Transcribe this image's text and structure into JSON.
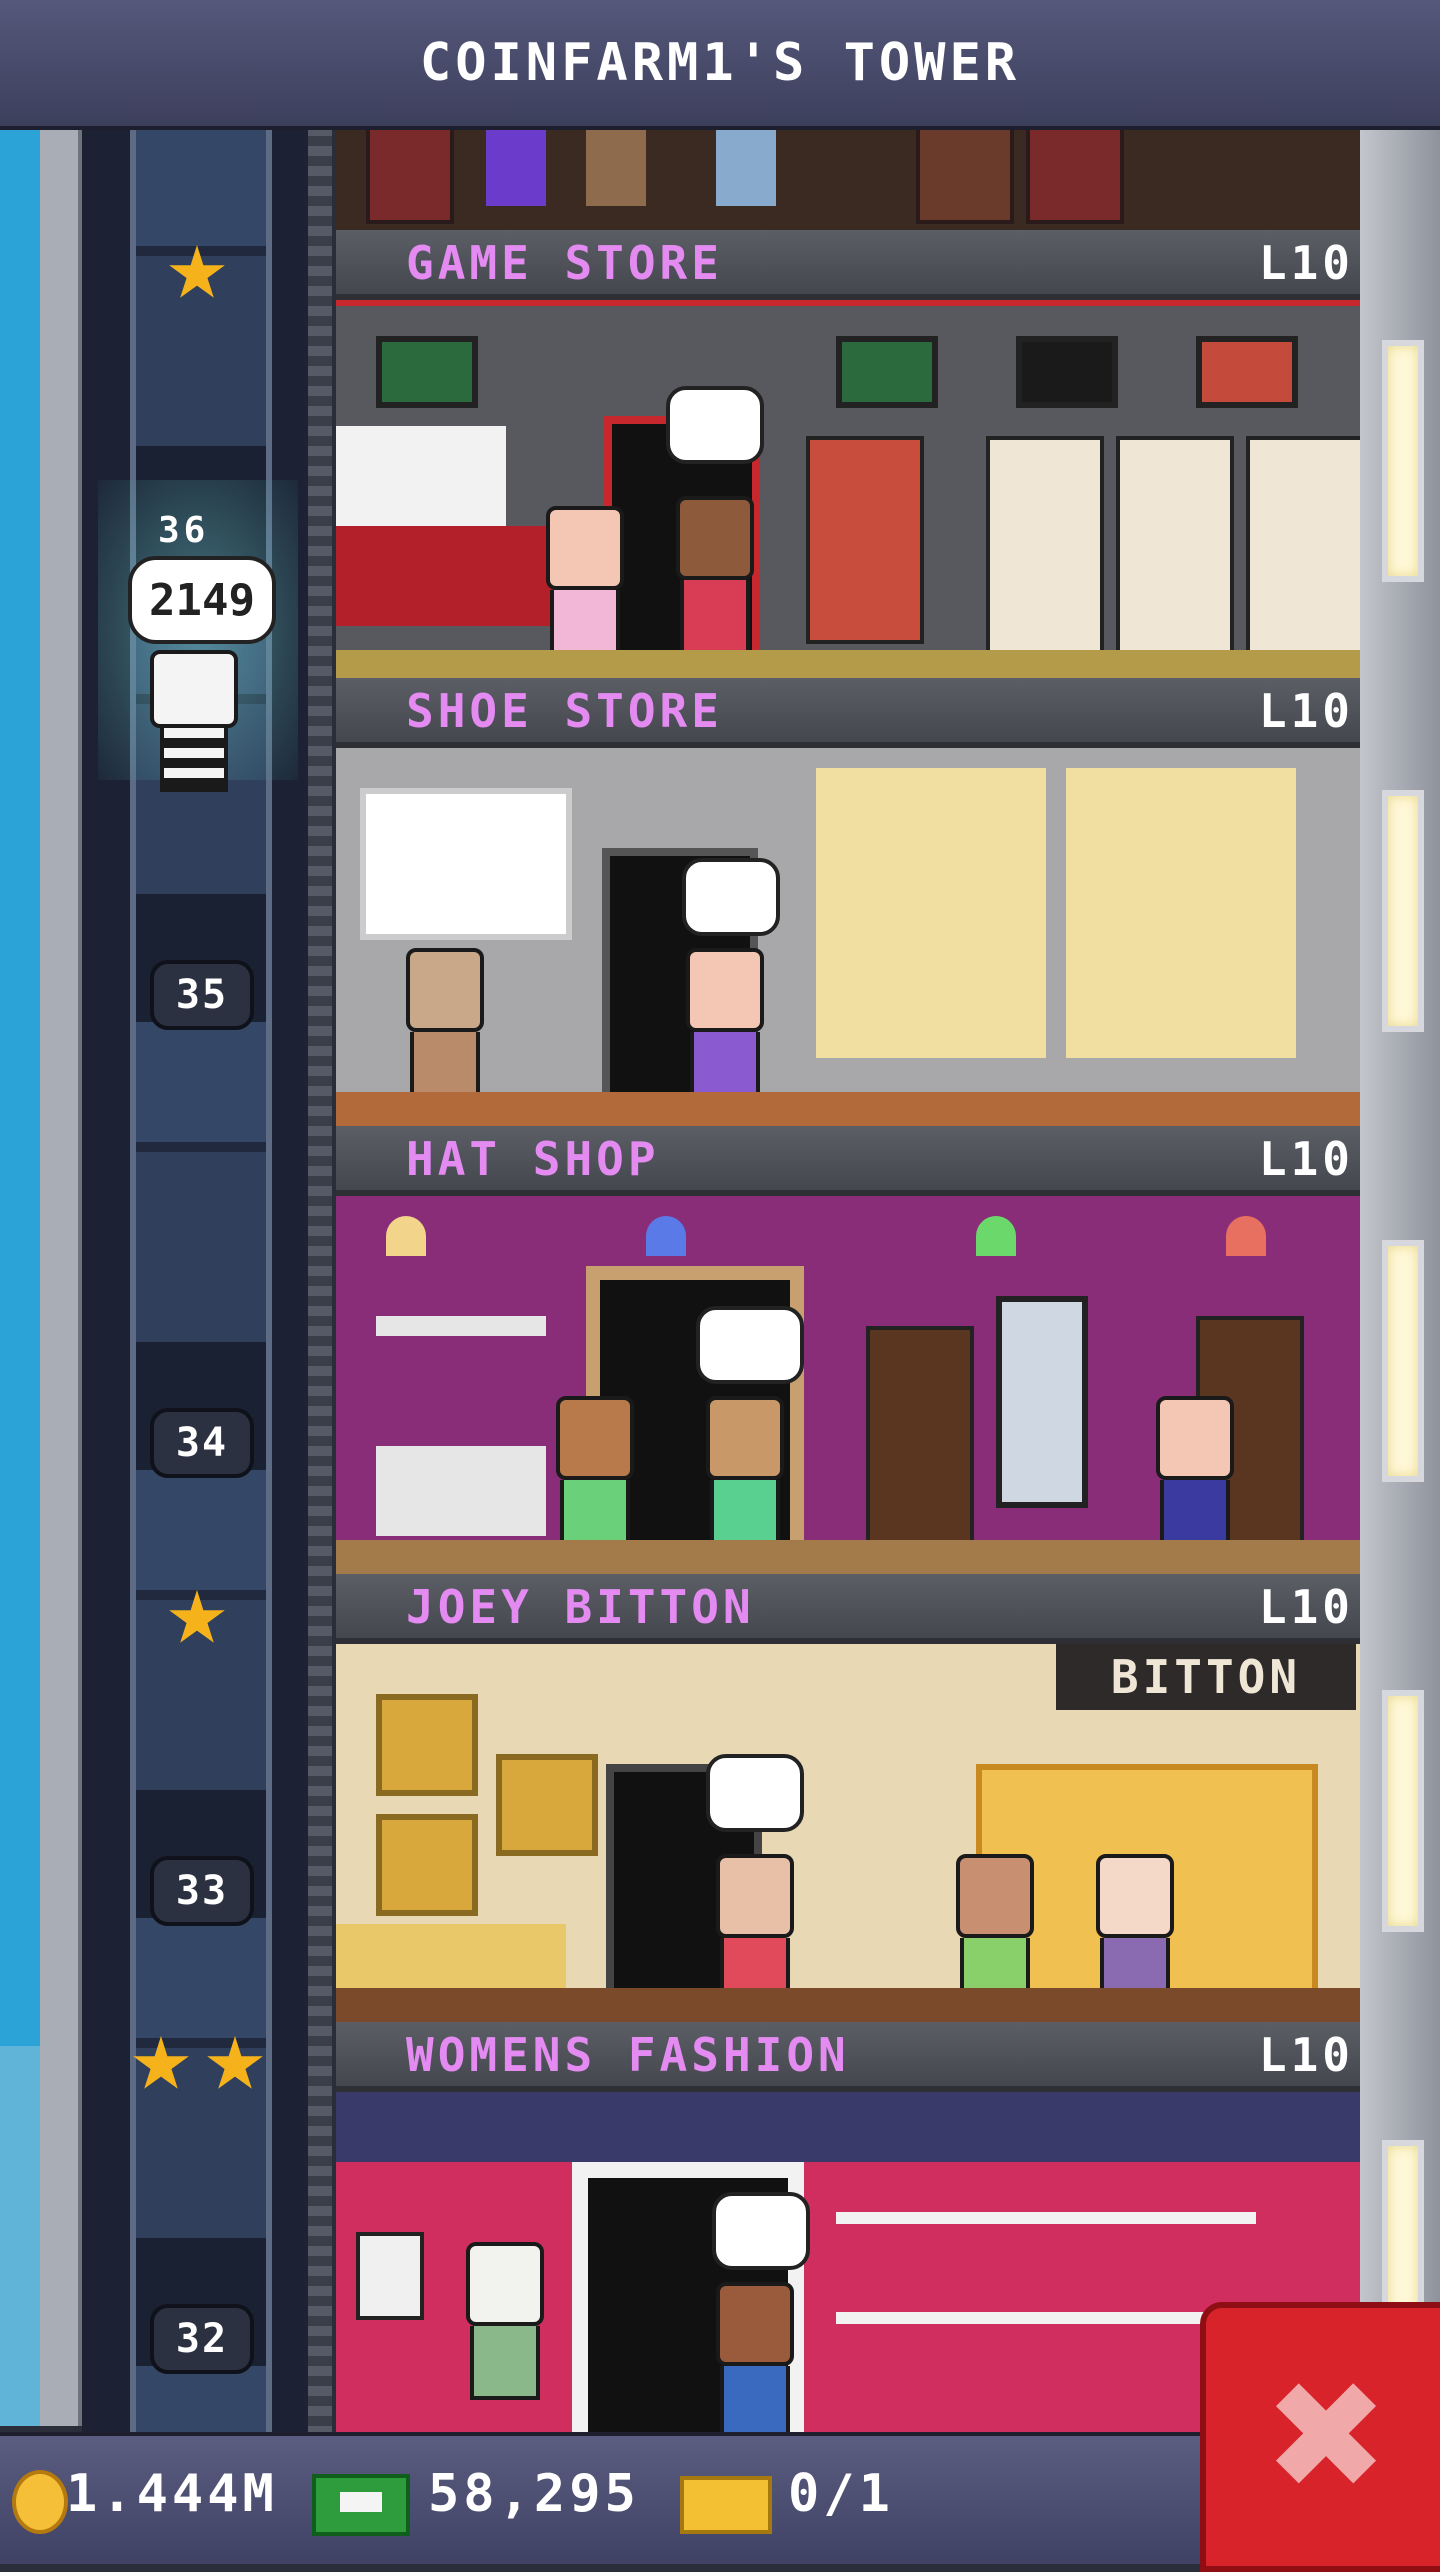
{
  "header": {
    "title": "COINFARM1'S TOWER"
  },
  "floors": [
    {
      "name": "GAME STORE",
      "level": "L10",
      "shaft_label": "36"
    },
    {
      "name": "SHOE STORE",
      "level": "L10",
      "shaft_label": "35"
    },
    {
      "name": "HAT SHOP",
      "level": "L10",
      "shaft_label": "34"
    },
    {
      "name": "JOEY BITTON",
      "level": "L10",
      "shaft_label": "33",
      "sign": "BITTON"
    },
    {
      "name": "WOMENS FASHION",
      "level": "L10",
      "shaft_label": "32"
    }
  ],
  "elevator": {
    "floor": "36",
    "badge": "2149"
  },
  "status": {
    "coins": "1.444M",
    "bux": "58,295",
    "tickets": "0/1"
  },
  "icons": {
    "coin": "coin-icon",
    "bux": "bux-cash-icon",
    "ticket": "golden-ticket-icon",
    "close": "close-icon",
    "star": "star-icon"
  },
  "colors": {
    "floor_name": "#e48bf2",
    "close_button": "#d8232a"
  }
}
